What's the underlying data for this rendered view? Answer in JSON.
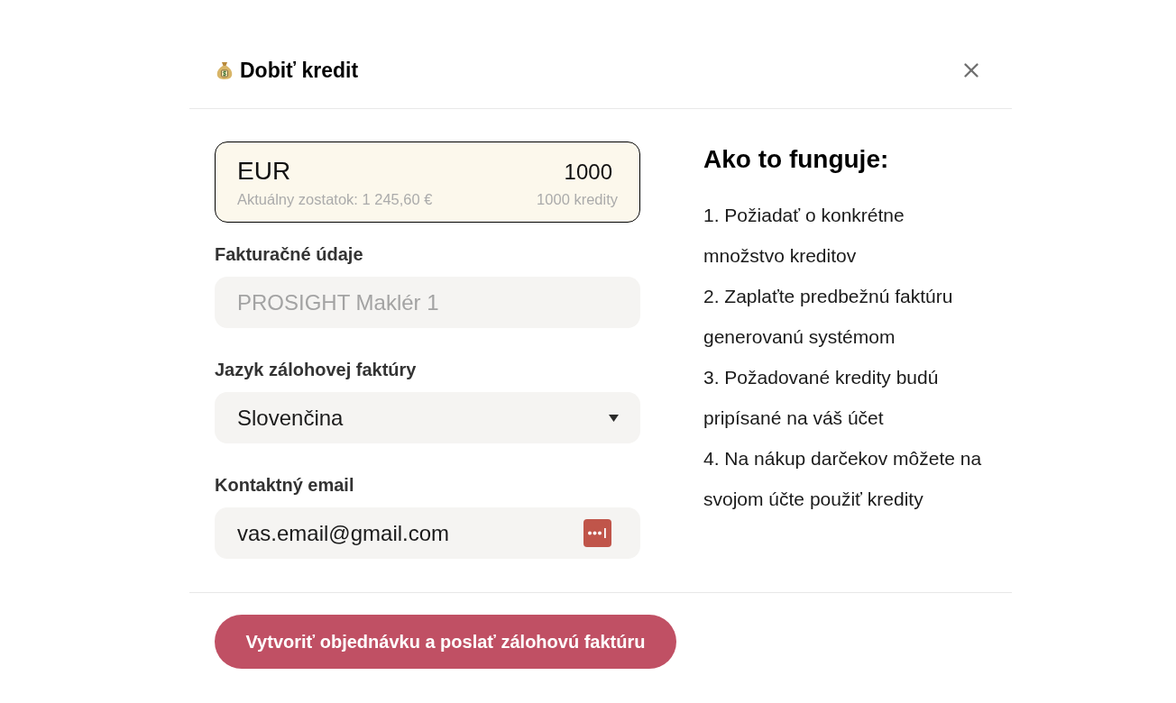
{
  "dialog": {
    "title": "Dobiť kredit"
  },
  "amount_card": {
    "currency": "EUR",
    "amount": "1000",
    "balance": "Aktuálny zostatok: 1 245,60 €",
    "credits": "1000 kredity"
  },
  "fields": [
    {
      "kind": "text",
      "label": "Fakturačné údaje",
      "value": "PROSIGHT Maklér 1",
      "disabled": true
    },
    {
      "kind": "select",
      "label": "Jazyk zálohovej faktúry",
      "value": "Slovenčina"
    },
    {
      "kind": "email",
      "label": "Kontaktný email",
      "value": "vas.email@gmail.com"
    }
  ],
  "how_it_works": {
    "title": "Ako to funguje:",
    "steps": [
      "1. Požiadať o konkrétne\nmnožstvo kreditov",
      "2. Zaplaťte predbežnú faktúru\ngenerovanú systémom",
      "3. Požadované kredity budú\npripísané na váš účet",
      "4. Na nákup darčekov môžete na\nsvojom účte použiť kredity"
    ]
  },
  "submit_button": {
    "label": "Vytvoriť objednávku a poslať zálohovú faktúru"
  }
}
